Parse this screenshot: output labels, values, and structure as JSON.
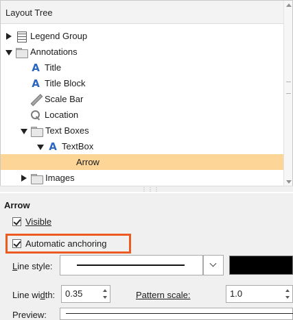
{
  "tree_panel": {
    "title": "Layout Tree",
    "items": [
      {
        "label": "Legend Group",
        "icon": "legend-icon",
        "state": "collapsed"
      },
      {
        "label": "Annotations",
        "icon": "folder-icon",
        "state": "expanded"
      },
      {
        "label": "Title",
        "icon": "text-icon",
        "state": "leaf"
      },
      {
        "label": "Title Block",
        "icon": "text-icon",
        "state": "leaf"
      },
      {
        "label": "Scale Bar",
        "icon": "scale-bar-icon",
        "state": "leaf"
      },
      {
        "label": "Location",
        "icon": "location-icon",
        "state": "leaf"
      },
      {
        "label": "Text Boxes",
        "icon": "folder-icon",
        "state": "expanded"
      },
      {
        "label": "TextBox",
        "icon": "text-icon",
        "state": "expanded"
      },
      {
        "label": "Arrow",
        "icon": "",
        "state": "leaf",
        "selected": true
      },
      {
        "label": "Images",
        "icon": "folder-icon",
        "state": "collapsed"
      }
    ]
  },
  "properties": {
    "title": "Arrow",
    "visible": {
      "label": "Visible",
      "checked": true
    },
    "auto_anchoring": {
      "label": "Automatic anchoring",
      "checked": true
    },
    "line_style_label": "Line style:",
    "line_color": "#000000",
    "line_width_label": "Line width:",
    "line_width_value": "0.35",
    "pattern_scale_label": "Pattern scale:",
    "pattern_scale_value": "1.0",
    "preview_label": "Preview:"
  },
  "colors": {
    "selection": "#fdd697",
    "highlight_border": "#ec5a20",
    "text_icon": "#2a66c2"
  }
}
